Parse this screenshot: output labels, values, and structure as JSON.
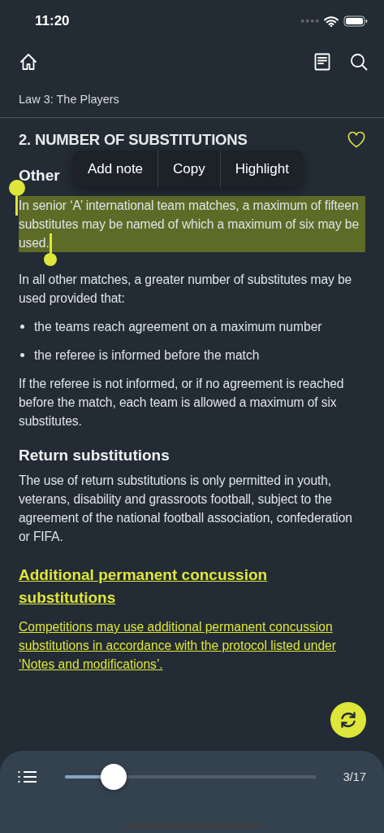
{
  "status_bar": {
    "time": "11:20"
  },
  "breadcrumb": "Law 3: The Players",
  "section": {
    "title": "2. NUMBER OF SUBSTITUTIONS",
    "favorite": true
  },
  "context_menu": [
    "Add note",
    "Copy",
    "Highlight"
  ],
  "blocks": [
    {
      "kind": "heading",
      "text": "Other"
    },
    {
      "kind": "paragraph",
      "text": "In senior ‘A’ international team matches, a maximum of fifteen substitutes may be named of which a maximum of six may be used.",
      "selected": true
    },
    {
      "kind": "paragraph",
      "text": "In all other matches, a greater number of substitutes may be used provided that:",
      "selected": false
    },
    {
      "kind": "bullet",
      "text": "the teams reach agreement on a maximum number"
    },
    {
      "kind": "bullet",
      "text": "the referee is informed before the match"
    },
    {
      "kind": "paragraph",
      "text": "If the referee is not informed, or if no agreement is reached before the match, each team is allowed a maximum of six substitutes.",
      "selected": false
    },
    {
      "kind": "heading",
      "text": "Return substitutions"
    },
    {
      "kind": "paragraph",
      "text": "The use of return substitutions is only permitted in youth, veterans, disability and grassroots football, subject to the agreement of the national football association, confederation or FIFA.",
      "selected": false
    },
    {
      "kind": "link_heading",
      "text": "Additional permanent concussion substitutions"
    },
    {
      "kind": "link",
      "text": "Competitions may use additional permanent concussion substitutions in accordance with the protocol listed under ‘Notes and modifications’."
    }
  ],
  "footer": {
    "level": 0.16,
    "page": "3/17"
  }
}
